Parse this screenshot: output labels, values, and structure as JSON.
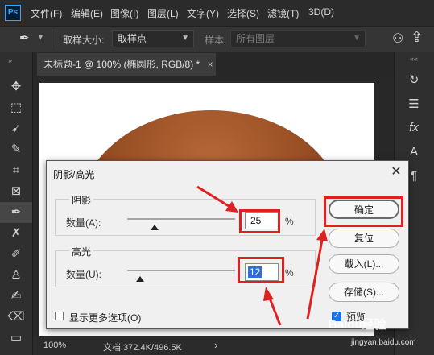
{
  "app": {
    "logo": "Ps"
  },
  "menu": [
    "文件(F)",
    "编辑(E)",
    "图像(I)",
    "图层(L)",
    "文字(Y)",
    "选择(S)",
    "滤镜(T)",
    "3D(D)"
  ],
  "options": {
    "sample_size_label": "取样大小:",
    "sample_size_value": "取样点",
    "sample_label": "样本:",
    "sample_value": "所有图层"
  },
  "document": {
    "tab_title": "未标题-1 @ 100% (椭圆形, RGB/8) *",
    "tab_close": "×"
  },
  "status": {
    "zoom": "100%",
    "doc_info": "文档:372.4K/496.5K",
    "arrow": "›"
  },
  "dialog": {
    "title": "阴影/高光",
    "close": "✕",
    "shadows": {
      "group_title": "阴影",
      "amount_label": "数量(A):",
      "amount_value": "25",
      "percent": "%",
      "slider_fraction": 0.25
    },
    "highlights": {
      "group_title": "高光",
      "amount_label": "数量(U):",
      "amount_value": "12",
      "percent": "%",
      "slider_fraction": 0.12
    },
    "show_more_label": "显示更多选项(O)",
    "buttons": {
      "ok": "确定",
      "reset": "复位",
      "load": "载入(L)...",
      "save": "存储(S)..."
    },
    "preview_label": "预览"
  },
  "watermark": {
    "brand": "Baidu经验",
    "url": "jingyan.baidu.com"
  },
  "colors": {
    "highlight_red": "#e02020",
    "selection_blue": "#2f6fd8",
    "ellipse": "#9c5226"
  }
}
